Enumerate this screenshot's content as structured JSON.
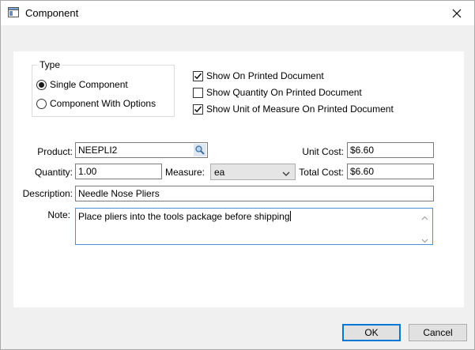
{
  "window": {
    "title": "Component"
  },
  "type_group": {
    "legend": "Type",
    "options": [
      {
        "label": "Single Component",
        "selected": true
      },
      {
        "label": "Component With Options",
        "selected": false
      }
    ]
  },
  "print_options": [
    {
      "label": "Show On Printed Document",
      "checked": true
    },
    {
      "label": "Show Quantity On Printed Document",
      "checked": false
    },
    {
      "label": "Show Unit of Measure On Printed Document",
      "checked": true
    }
  ],
  "form": {
    "product_label": "Product:",
    "product_value": "NEEPLI2",
    "unit_cost_label": "Unit Cost:",
    "unit_cost_value": "$6.60",
    "quantity_label": "Quantity:",
    "quantity_value": "1.00",
    "measure_label": "Measure:",
    "measure_value": "ea",
    "total_cost_label": "Total Cost:",
    "total_cost_value": "$6.60",
    "description_label": "Description:",
    "description_value": "Needle Nose Pliers",
    "note_label": "Note:",
    "note_value": "Place pliers into the tools package before shipping"
  },
  "buttons": {
    "ok": "OK",
    "cancel": "Cancel"
  },
  "icons": {
    "app": "window-icon",
    "close": "close-icon",
    "lookup": "magnifier-icon",
    "dropdown": "chevron-down-icon"
  },
  "colors": {
    "focus_border": "#0078d7",
    "note_border": "#4a90d9"
  }
}
